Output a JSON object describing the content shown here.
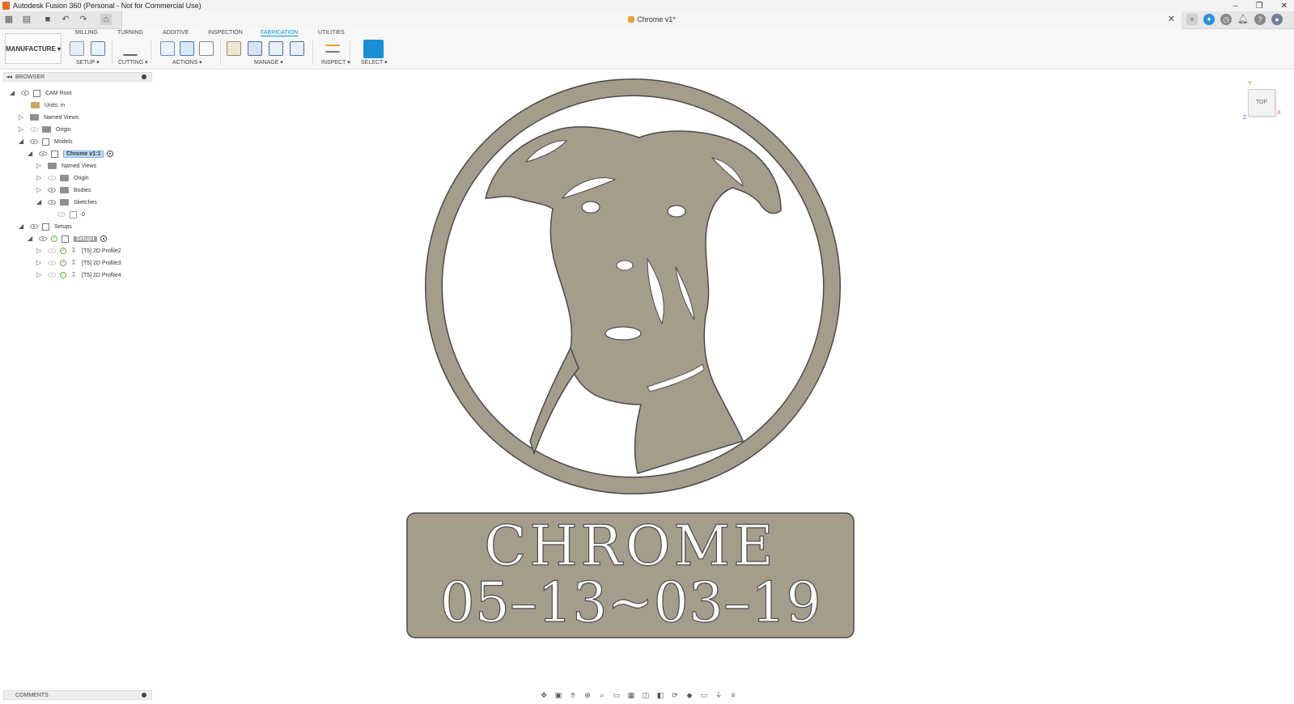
{
  "window": {
    "title": "Autodesk Fusion 360 (Personal - Not for Commercial Use)",
    "controls": {
      "minimize": "–",
      "restore": "❐",
      "close": "✕"
    }
  },
  "document": {
    "tab_title": "Chrome v1*",
    "close": "✕"
  },
  "workspace": {
    "label": "MANUFACTURE ▾"
  },
  "ribbon": {
    "tabs": [
      "MILLING",
      "TURNING",
      "ADDITIVE",
      "INSPECTION",
      "FABRICATION",
      "UTILITIES"
    ],
    "active_tab": "FABRICATION",
    "groups": [
      "SETUP ▾",
      "CUTTING ▾",
      "ACTIONS ▾",
      "MANAGE ▾",
      "INSPECT ▾",
      "SELECT ▾"
    ]
  },
  "browser": {
    "title": "BROWSER",
    "collapse": "◂◂",
    "tree": {
      "cam_root": "CAM Root",
      "units": "Units: in",
      "named_views": "Named Views",
      "origin": "Origin",
      "models": "Models",
      "component": "Chrome v1:1",
      "comp_named_views": "Named Views",
      "comp_origin": "Origin",
      "bodies": "Bodies",
      "sketches": "Sketches",
      "sketch_0": "0",
      "setups": "Setups",
      "setup1": "Setup1",
      "op1": "[T5] 2D Profile2",
      "op2": "[T5] 2D Profile3",
      "op3": "[T5] 2D Profile4"
    }
  },
  "model": {
    "line1": "CHROME",
    "line2": "05–13~03–19",
    "fill_color": "#a59d8c",
    "stroke_color": "#4b4b4b"
  },
  "viewcube": {
    "face": "TOP",
    "axis_x": "X",
    "axis_y": "Y",
    "axis_z": "Z"
  },
  "comments": {
    "title": "COMMENTS"
  },
  "colors": {
    "accent": "#0696d7",
    "check_green": "#6cb04a"
  }
}
